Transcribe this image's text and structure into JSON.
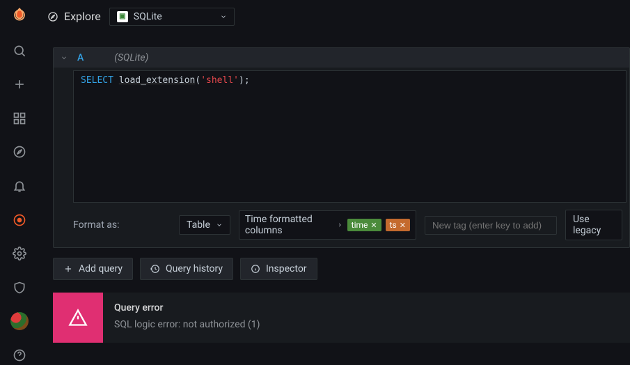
{
  "topbar": {
    "title": "Explore",
    "datasource": "SQLite"
  },
  "query": {
    "ref": "A",
    "ds_hint": "(SQLite)",
    "sql": {
      "keyword": "SELECT",
      "func": "load_extension",
      "string": "'shell'"
    }
  },
  "format": {
    "label": "Format as:",
    "value": "Table",
    "tfc_label": "Time formatted columns",
    "tags": {
      "time": "time",
      "ts": "ts"
    },
    "new_tag_placeholder": "New tag (enter key to add)",
    "legacy": "Use legacy"
  },
  "actions": {
    "add_query": "Add query",
    "query_history": "Query history",
    "inspector": "Inspector"
  },
  "error": {
    "title": "Query error",
    "message": "SQL logic error: not authorized (1)"
  }
}
